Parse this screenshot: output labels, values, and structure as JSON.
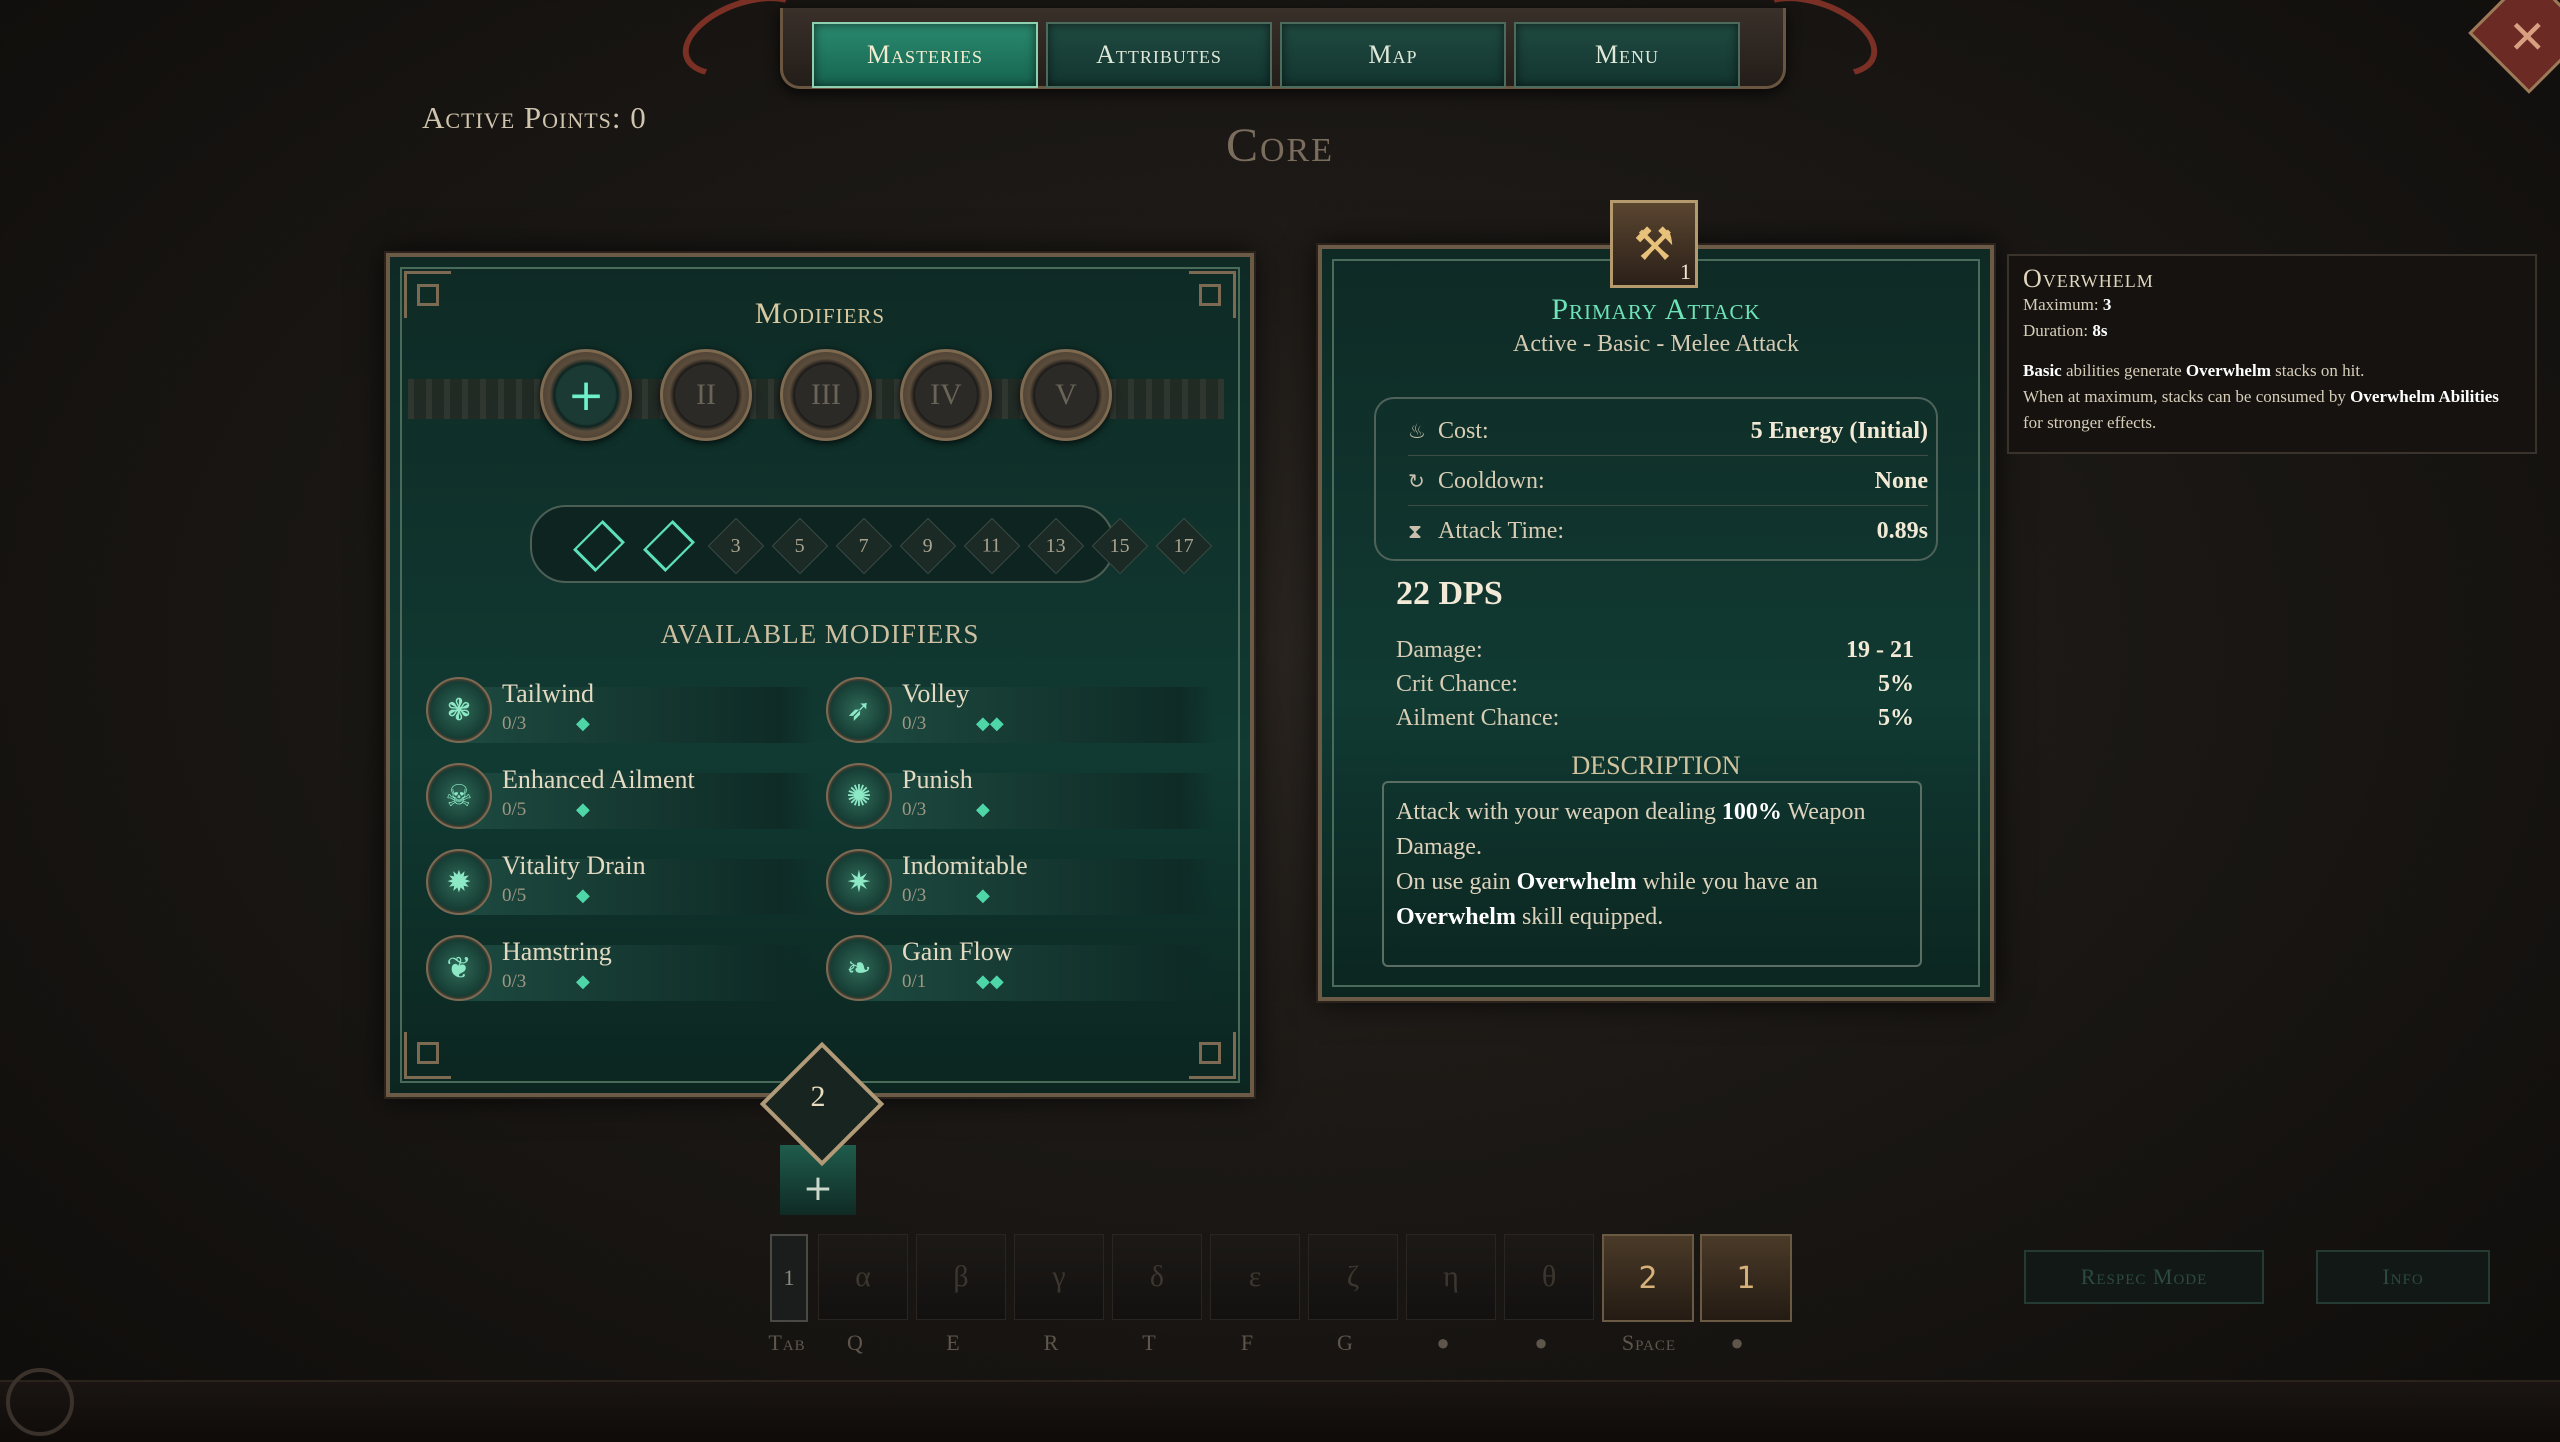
{
  "nav": {
    "tabs": [
      {
        "label": "Masteries",
        "active": true
      },
      {
        "label": "Attributes",
        "active": false
      },
      {
        "label": "Map",
        "active": false
      },
      {
        "label": "Menu",
        "active": false
      }
    ]
  },
  "active_points_label": "Active Points: 0",
  "section_title": "Core",
  "close_icon": "close-icon",
  "modifiers": {
    "heading": "Modifiers",
    "tiers": [
      "+",
      "II",
      "III",
      "IV",
      "V"
    ],
    "point_track": {
      "filled": 2,
      "thresholds": [
        "3",
        "5",
        "7",
        "9",
        "11",
        "13",
        "15",
        "17"
      ]
    },
    "available_heading": "AVAILABLE MODIFIERS",
    "items": [
      {
        "name": "Tailwind",
        "count": "0/3",
        "cost": "◆"
      },
      {
        "name": "Volley",
        "count": "0/3",
        "cost": "◆◆"
      },
      {
        "name": "Enhanced Ailment",
        "count": "0/5",
        "cost": "◆"
      },
      {
        "name": "Punish",
        "count": "0/3",
        "cost": "◆"
      },
      {
        "name": "Vitality Drain",
        "count": "0/5",
        "cost": "◆"
      },
      {
        "name": "Indomitable",
        "count": "0/3",
        "cost": "◆"
      },
      {
        "name": "Hamstring",
        "count": "0/3",
        "cost": "◆"
      },
      {
        "name": "Gain Flow",
        "count": "0/1",
        "cost": "◆◆"
      }
    ],
    "points_badge": "2",
    "add_label": "+"
  },
  "ability": {
    "icon_level": "1",
    "title": "Primary Attack",
    "subtitle": "Active - Basic - Melee Attack",
    "cost_label": "Cost:",
    "cost_value": "5 Energy (Initial)",
    "cooldown_label": "Cooldown:",
    "cooldown_value": "None",
    "attack_time_label": "Attack Time:",
    "attack_time_value": "0.89s",
    "dps": "22 DPS",
    "damage_label": "Damage:",
    "damage_value": "19 - 21",
    "crit_label": "Crit Chance:",
    "crit_value": "5%",
    "ailment_label": "Ailment Chance:",
    "ailment_value": "5%",
    "description_heading": "DESCRIPTION",
    "desc": {
      "p1": "Attack with your weapon dealing ",
      "b1": "100%",
      "p2": " Weapon Damage.",
      "p3": "On use gain ",
      "b2": "Overwhelm",
      "p4": " while you have an ",
      "b3": "Overwhelm",
      "p5": " skill equipped."
    }
  },
  "tooltip": {
    "title": "Overwhelm",
    "max_label": "Maximum:",
    "max_value": "3",
    "dur_label": "Duration:",
    "dur_value": "8s",
    "l1a": "Basic",
    "l1b": " abilities generate ",
    "l1c": "Overwhelm",
    "l1d": " stacks on hit.",
    "l2a": "When at maximum, stacks can be consumed by ",
    "l2b": "Overwhelm Abilities",
    "l2c": " for stronger effects."
  },
  "hotbar": {
    "slots": [
      "1",
      "α",
      "β",
      "γ",
      "δ",
      "ε",
      "ζ",
      "η",
      "θ",
      "2",
      "1"
    ],
    "keys": [
      "Tab",
      "Q",
      "E",
      "R",
      "T",
      "F",
      "G",
      "",
      "",
      "Space",
      ""
    ]
  },
  "respec_label": "Respec Mode",
  "info_label": "Info"
}
